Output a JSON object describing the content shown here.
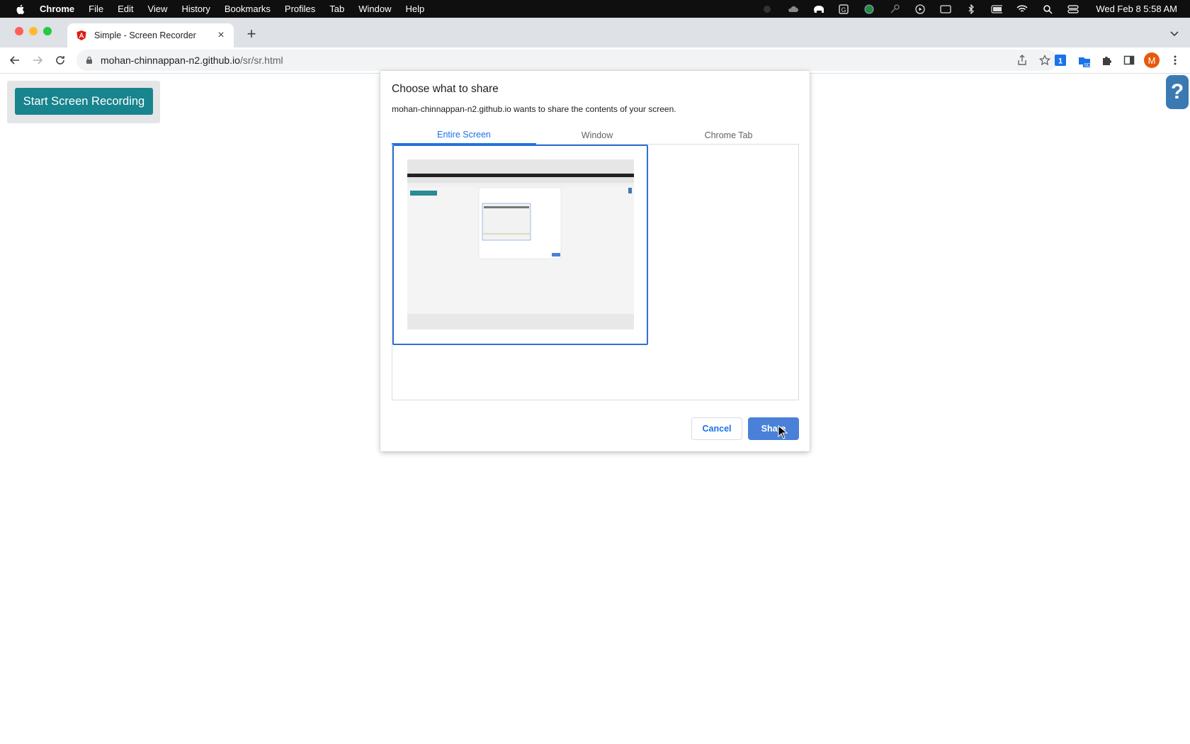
{
  "menubar": {
    "app_name": "Chrome",
    "items": [
      "File",
      "Edit",
      "View",
      "History",
      "Bookmarks",
      "Profiles",
      "Tab",
      "Window",
      "Help"
    ],
    "clock": "Wed Feb 8  5:58 AM"
  },
  "browser": {
    "tab_title": "Simple - Screen Recorder",
    "url_host": "mohan-chinnappan-n2.github.io",
    "url_path": "/sr/sr.html",
    "profile_initial": "M",
    "extension_badge_1": "1",
    "extension_badge_2": "SD"
  },
  "page": {
    "record_button_label": "Start Screen Recording",
    "help_label": "?"
  },
  "dialog": {
    "title": "Choose what to share",
    "subtitle": "mohan-chinnappan-n2.github.io wants to share the contents of your screen.",
    "tabs": [
      "Entire Screen",
      "Window",
      "Chrome Tab"
    ],
    "active_tab": "Entire Screen",
    "cancel_label": "Cancel",
    "share_label": "Share"
  },
  "colors": {
    "record_button": "#17848e",
    "help_button": "#3b79b2",
    "accent": "#1a73e8",
    "share_button": "#4a80d8"
  }
}
